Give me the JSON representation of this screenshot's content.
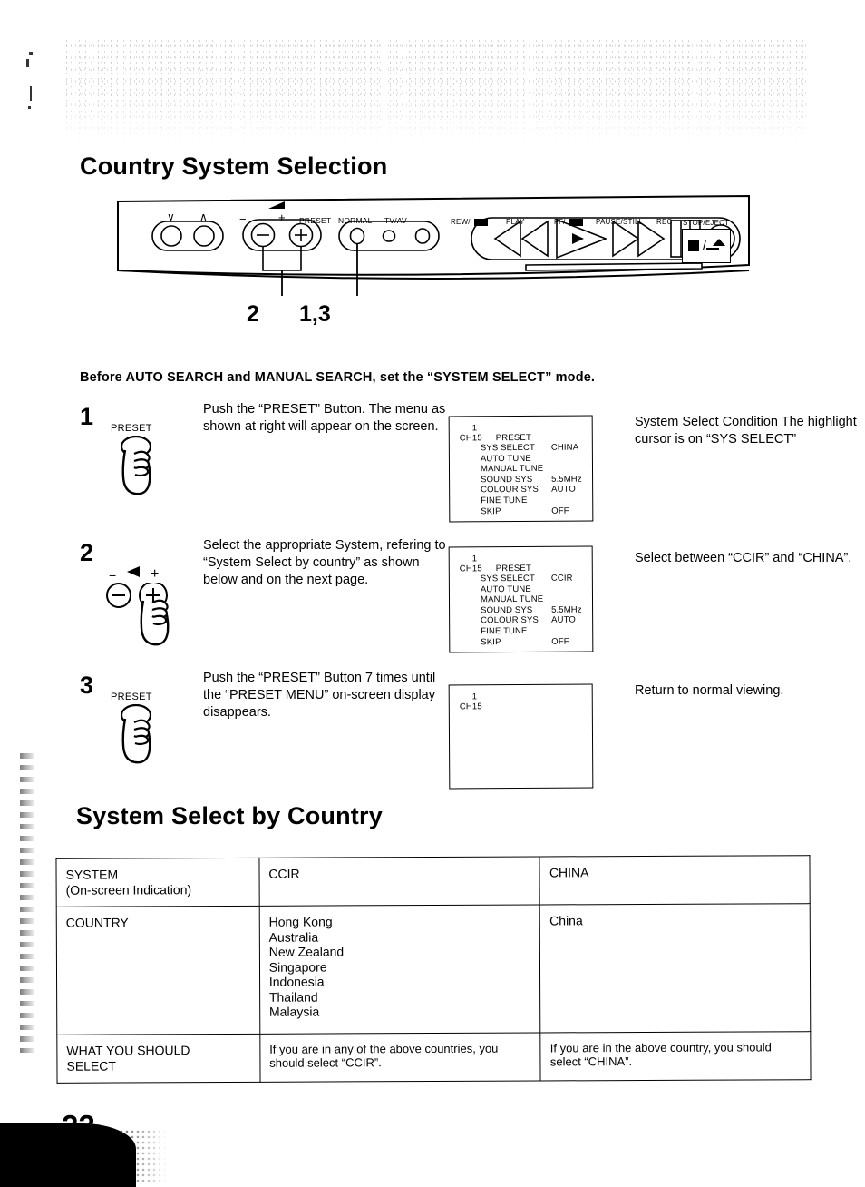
{
  "page_title": "Country System Selection",
  "panel": {
    "labels": {
      "ch_down": "∨",
      "ch_up": "∧",
      "vol_minus": "−",
      "vol_plus": "+",
      "preset": "PRESET",
      "normal": "NORMAL",
      "tv_av": "TV/AV",
      "rew": "REW/",
      "play": "PLAY",
      "ff": "FF/",
      "pause_still": "PAUSE/STILL",
      "rec": "REC",
      "stop_eject": "STOP/EJECT"
    },
    "callouts": {
      "volume": "2",
      "preset": "1,3"
    }
  },
  "intro_line": "Before AUTO SEARCH and MANUAL SEARCH, set the “SYSTEM SELECT” mode.",
  "steps": [
    {
      "number": "1",
      "icon_label": "PRESET",
      "text": "Push the “PRESET” Button. The menu as shown at right will appear on the screen.",
      "note": "System Select Condition The highlight cursor is on “SYS SELECT”",
      "osd": {
        "channel_number": "1",
        "channel": "CH15",
        "menu_title": "PRESET",
        "items": [
          "SYS SELECT",
          "AUTO TUNE",
          "MANUAL TUNE",
          "SOUND SYS",
          "COLOUR SYS",
          "FINE TUNE",
          "SKIP"
        ],
        "values": [
          "CHINA",
          "",
          "",
          "5.5MHz",
          "AUTO",
          "",
          "OFF"
        ]
      }
    },
    {
      "number": "2",
      "icon_label": "",
      "text": "Select the appropriate System, refering to “System Select by country” as shown below and on the next page.",
      "note": "Select between “CCIR” and “CHINA”.",
      "osd": {
        "channel_number": "1",
        "channel": "CH15",
        "menu_title": "PRESET",
        "items": [
          "SYS SELECT",
          "AUTO TUNE",
          "MANUAL TUNE",
          "SOUND SYS",
          "COLOUR SYS",
          "FINE TUNE",
          "SKIP"
        ],
        "values": [
          "CCIR",
          "",
          "",
          "5.5MHz",
          "AUTO",
          "",
          "OFF"
        ]
      }
    },
    {
      "number": "3",
      "icon_label": "PRESET",
      "text": "Push the “PRESET” Button 7 times until the “PRESET MENU” on-screen display disappears.",
      "note": "Return to normal viewing.",
      "osd": {
        "channel_number": "1",
        "channel": "CH15",
        "menu_title": "",
        "items": [],
        "values": []
      }
    }
  ],
  "country_table_title": "System Select by Country",
  "country_table": {
    "row_system_label_line1": "SYSTEM",
    "row_system_label_line2": "(On-screen Indication)",
    "system_ccir": "CCIR",
    "system_china": "CHINA",
    "row_country_label": "COUNTRY",
    "countries_ccir": [
      "Hong Kong",
      "Australia",
      "New Zealand",
      "Singapore",
      "Indonesia",
      "Thailand",
      "Malaysia"
    ],
    "countries_china": [
      "China"
    ],
    "row_select_label_line1": "WHAT YOU SHOULD",
    "row_select_label_line2": "SELECT",
    "select_ccir": "If you are in any of the above countries, you should select “CCIR”.",
    "select_china": "If you are in the above country, you should select “CHINA”."
  },
  "page_number": "22"
}
